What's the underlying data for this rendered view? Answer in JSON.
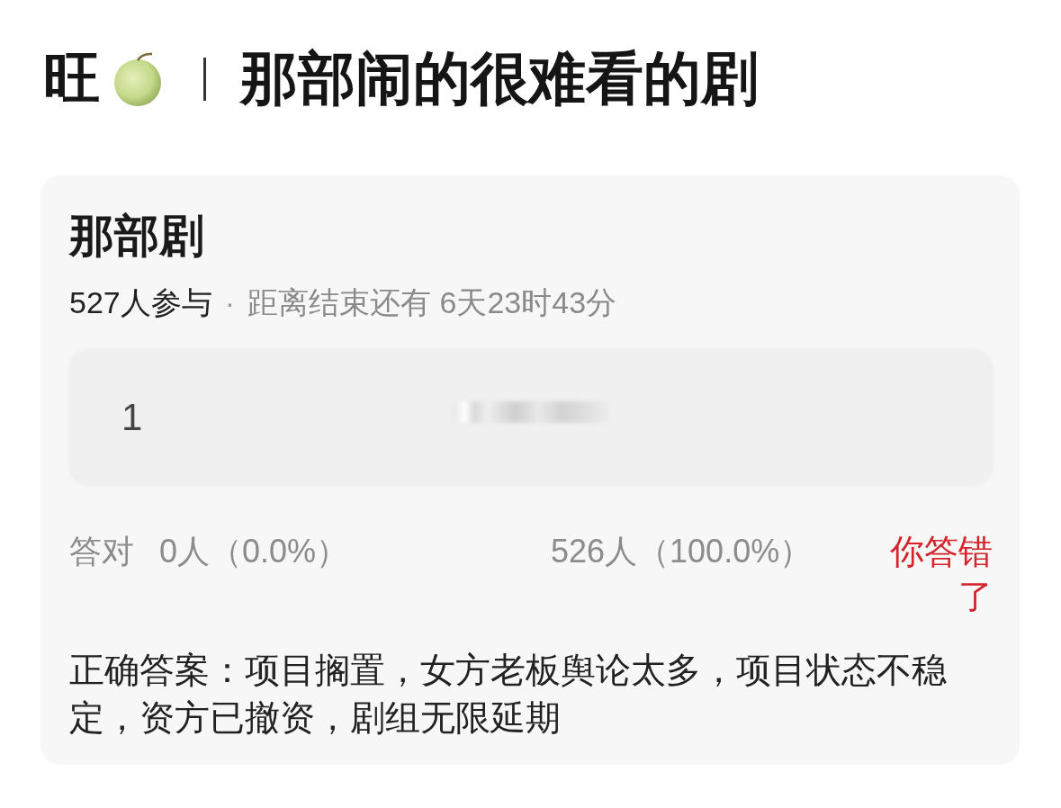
{
  "header": {
    "prefix": "旺",
    "title": "那部闹的很难看的剧"
  },
  "poll": {
    "title": "那部剧",
    "participants": "527人参与",
    "separator": "·",
    "countdown": "距离结束还有 6天23时43分",
    "options": [
      {
        "label": "1"
      }
    ],
    "stats": {
      "correct_label": "答对",
      "correct_count": "0人（0.0%）",
      "wrong_count": "526人（100.0%）",
      "verdict": "你答错了"
    },
    "answer": "正确答案：项目搁置，女方老板舆论太多，项目状态不稳定，资方已撤资，剧组无限延期"
  }
}
